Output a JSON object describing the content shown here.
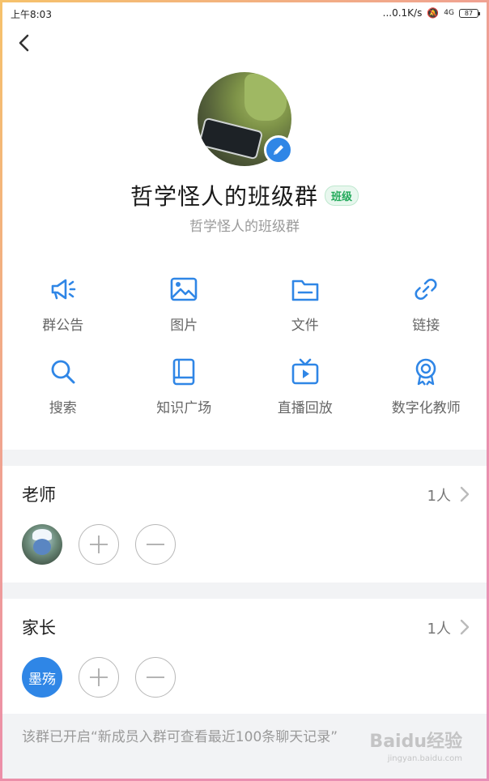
{
  "status_bar": {
    "time": "上午8:03",
    "network": "...0.1K/s",
    "signal": "4G",
    "battery": "87"
  },
  "header": {
    "back_icon": "chevron-left-icon"
  },
  "group": {
    "title": "哲学怪人的班级群",
    "tag": "班级",
    "subtitle": "哲学怪人的班级群"
  },
  "features": [
    {
      "label": "群公告",
      "icon": "megaphone-icon"
    },
    {
      "label": "图片",
      "icon": "image-icon"
    },
    {
      "label": "文件",
      "icon": "folder-icon"
    },
    {
      "label": "链接",
      "icon": "link-icon"
    },
    {
      "label": "搜索",
      "icon": "search-icon"
    },
    {
      "label": "知识广场",
      "icon": "book-icon"
    },
    {
      "label": "直播回放",
      "icon": "tv-play-icon"
    },
    {
      "label": "数字化教师",
      "icon": "award-icon"
    }
  ],
  "teachers": {
    "title": "老师",
    "count": "1人"
  },
  "parents": {
    "title": "家长",
    "count": "1人",
    "member_name": "墨殇"
  },
  "notice": {
    "text": "该群已开启“新成员入群可查看最近100条聊天记录”"
  },
  "watermark": {
    "text": "Baidu经验",
    "sub": "jingyan.baidu.com"
  },
  "colors": {
    "accent": "#2f86e6",
    "tag_green": "#22a95a"
  }
}
